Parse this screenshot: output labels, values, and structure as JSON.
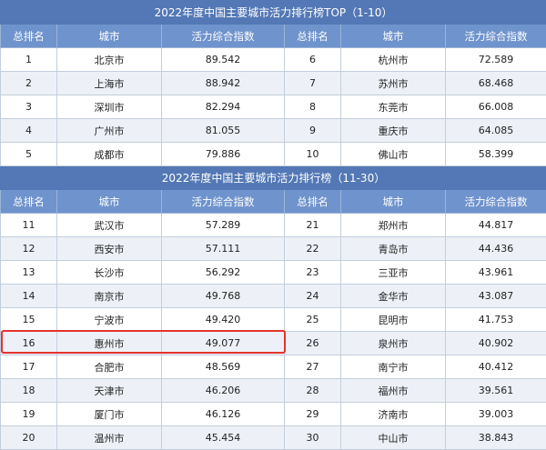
{
  "section1": {
    "title": "2022年度中国主要城市活力排行榜TOP（1-10）",
    "headers": [
      "总排名",
      "城市",
      "活力综合指数",
      "总排名",
      "城市",
      "活力综合指数"
    ],
    "rows": [
      [
        "1",
        "北京市",
        "89.542",
        "6",
        "杭州市",
        "72.589"
      ],
      [
        "2",
        "上海市",
        "88.942",
        "7",
        "苏州市",
        "68.468"
      ],
      [
        "3",
        "深圳市",
        "82.294",
        "8",
        "东莞市",
        "66.008"
      ],
      [
        "4",
        "广州市",
        "81.055",
        "9",
        "重庆市",
        "64.085"
      ],
      [
        "5",
        "成都市",
        "79.886",
        "10",
        "佛山市",
        "58.399"
      ]
    ]
  },
  "section2": {
    "title": "2022年度中国主要城市活力排行榜（11-30）",
    "headers": [
      "总排名",
      "城市",
      "活力综合指数",
      "总排名",
      "城市",
      "活力综合指数"
    ],
    "rows": [
      [
        "11",
        "武汉市",
        "57.289",
        "21",
        "郑州市",
        "44.817"
      ],
      [
        "12",
        "西安市",
        "57.111",
        "22",
        "青岛市",
        "44.436"
      ],
      [
        "13",
        "长沙市",
        "56.292",
        "23",
        "三亚市",
        "43.961"
      ],
      [
        "14",
        "南京市",
        "49.768",
        "24",
        "金华市",
        "43.087"
      ],
      [
        "15",
        "宁波市",
        "49.420",
        "25",
        "昆明市",
        "41.753"
      ],
      [
        "16",
        "惠州市",
        "49.077",
        "26",
        "泉州市",
        "40.902"
      ],
      [
        "17",
        "合肥市",
        "48.569",
        "27",
        "南宁市",
        "40.412"
      ],
      [
        "18",
        "天津市",
        "46.206",
        "28",
        "福州市",
        "39.561"
      ],
      [
        "19",
        "厦门市",
        "46.126",
        "29",
        "济南市",
        "39.003"
      ],
      [
        "20",
        "温州市",
        "45.454",
        "30",
        "中山市",
        "38.843"
      ]
    ]
  },
  "highlight_color": "#e6322e"
}
